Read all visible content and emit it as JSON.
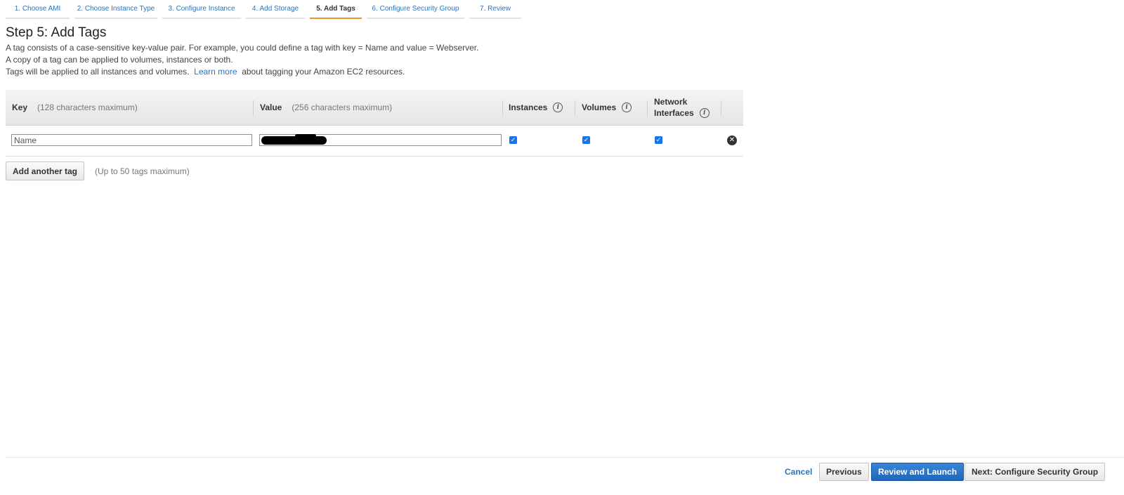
{
  "wizard": {
    "steps": [
      {
        "label": "1. Choose AMI",
        "active": false
      },
      {
        "label": "2. Choose Instance Type",
        "active": false
      },
      {
        "label": "3. Configure Instance",
        "active": false
      },
      {
        "label": "4. Add Storage",
        "active": false
      },
      {
        "label": "5. Add Tags",
        "active": true
      },
      {
        "label": "6. Configure Security Group",
        "active": false
      },
      {
        "label": "7. Review",
        "active": false
      }
    ]
  },
  "page": {
    "title": "Step 5: Add Tags",
    "desc1": "A tag consists of a case-sensitive key-value pair. For example, you could define a tag with key = Name and value = Webserver.",
    "desc2": "A copy of a tag can be applied to volumes, instances or both.",
    "desc3_before": "Tags will be applied to all instances and volumes.",
    "learn_more": "Learn more",
    "desc3_after": "about tagging your Amazon EC2 resources."
  },
  "table": {
    "headers": {
      "key": "Key",
      "key_hint": "(128 characters maximum)",
      "value": "Value",
      "value_hint": "(256 characters maximum)",
      "instances": "Instances",
      "volumes": "Volumes",
      "network_line1": "Network",
      "network_line2": "Interfaces"
    },
    "rows": [
      {
        "key": "Name",
        "value_redacted": true,
        "instances": true,
        "volumes": true,
        "network_interfaces": true
      }
    ]
  },
  "actions": {
    "add_tag": "Add another tag",
    "max_note": "(Up to 50 tags maximum)"
  },
  "footer": {
    "cancel": "Cancel",
    "previous": "Previous",
    "review_launch": "Review and Launch",
    "next": "Next: Configure Security Group"
  },
  "colors": {
    "link": "#2e73b8",
    "active_step": "#ec912d",
    "primary_button": "#1f66b8"
  }
}
